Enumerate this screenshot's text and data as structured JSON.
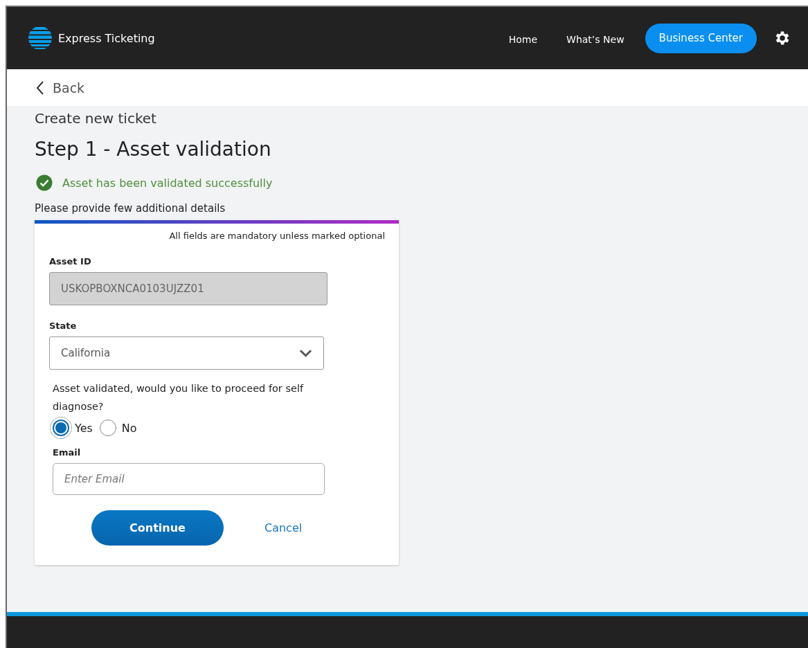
{
  "header": {
    "brand": "Express Ticketing",
    "nav": [
      "Home",
      "What’s New"
    ],
    "primary_button": "Business Center"
  },
  "back": {
    "label": "Back"
  },
  "page_title": "Create new ticket",
  "step_title": "Step 1 - Asset validation",
  "success_message": "Asset has been validated successfully",
  "form_intro": "Please provide few additional details",
  "form": {
    "note": "All fields are mandatory unless marked optional",
    "asset_id": {
      "label": "Asset ID",
      "value": "USKOPBOXNCA0103UJZZ01",
      "disabled": true
    },
    "state": {
      "label": "State",
      "value": "California"
    },
    "question": "Asset validated, would you like to proceed for self diagnose?",
    "options": [
      {
        "label": "Yes",
        "selected": true
      },
      {
        "label": "No",
        "selected": false
      }
    ],
    "email": {
      "label": "Email",
      "placeholder": "Enter Email"
    },
    "buttons": {
      "continue": "Continue",
      "cancel": "Cancel"
    }
  }
}
